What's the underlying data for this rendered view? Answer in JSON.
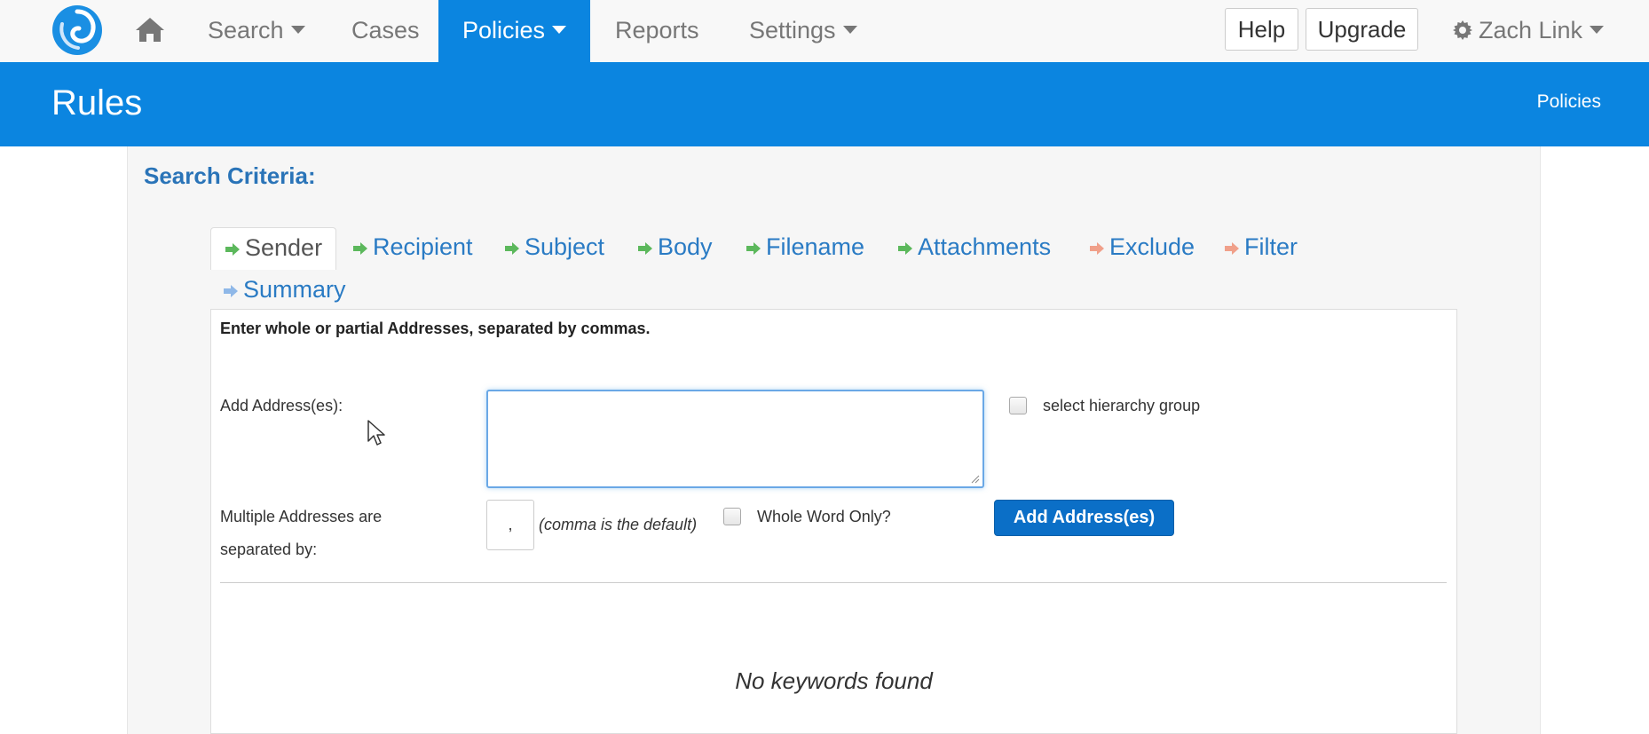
{
  "navbar": {
    "logo_icon": "swirl-logo-icon",
    "home_icon": "home-icon",
    "items": {
      "search": "Search",
      "cases": "Cases",
      "policies": "Policies",
      "reports": "Reports",
      "settings": "Settings"
    },
    "help_label": "Help",
    "upgrade_label": "Upgrade",
    "user_name": "Zach Link",
    "accent_color": "#0b85e0"
  },
  "header": {
    "title": "Rules",
    "breadcrumb": "Policies"
  },
  "search_criteria": {
    "title": "Search Criteria:",
    "tabs": {
      "sender": "Sender",
      "recipient": "Recipient",
      "subject": "Subject",
      "body": "Body",
      "filename": "Filename",
      "attachments": "Attachments",
      "exclude": "Exclude",
      "filter": "Filter",
      "summary": "Summary"
    },
    "active_tab": "Sender",
    "tab_arrow_colors": {
      "include": "#5cb85c",
      "exclude": "#f0a08a",
      "summary": "#8fb8e8"
    }
  },
  "form": {
    "instructions": "Enter whole or partial Addresses, separated by commas.",
    "add_address_label": "Add Address(es):",
    "address_value": "",
    "hierarchy_label": "select hierarchy group",
    "separator_label_line1": "Multiple Addresses are",
    "separator_label_line2": "separated by:",
    "separator_value": ",",
    "separator_hint": "(comma is the default)",
    "whole_word_label": "Whole Word Only?",
    "add_button": "Add Address(es)",
    "empty_message": "No keywords found"
  }
}
